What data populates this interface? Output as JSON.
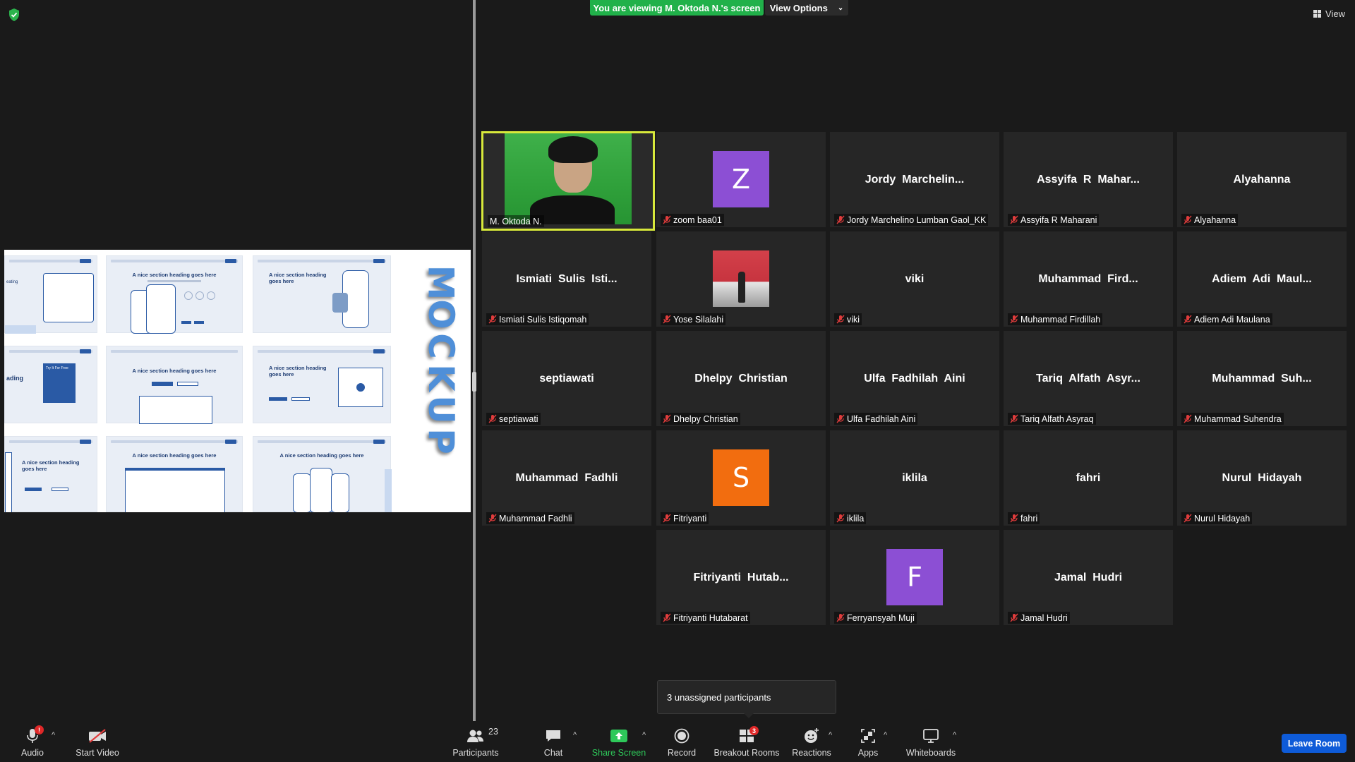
{
  "banner": {
    "viewing_text": "You are viewing M. Oktoda N.'s screen",
    "view_options_label": "View Options",
    "view_label": "View"
  },
  "shared_screen": {
    "headings": [
      "A nice section heading goes here",
      "A nice section heading goes here",
      "A nice section heading goes here",
      "A nice section heading goes here",
      "A nice section heading goes here",
      "A nice section heading goes here",
      "A nice section heading goes here",
      "A nice section heading goes here"
    ],
    "partial_left_texts": [
      "eating",
      "ading",
      "Try It For Free"
    ],
    "mockup_title": "MOCKUP"
  },
  "participants": [
    {
      "center": "",
      "label": "M. Oktoda N.",
      "type": "video",
      "muted": false
    },
    {
      "center": "",
      "label": "zoom baa01",
      "type": "avatar",
      "avatar_letter": "Z",
      "avatar_color": "#8c4fd4",
      "muted": true
    },
    {
      "center": "Jordy  Marchelin...",
      "label": "Jordy Marchelino Lumban Gaol_KK",
      "type": "name",
      "muted": true
    },
    {
      "center": "Assyifa  R  Mahar...",
      "label": "Assyifa R Maharani",
      "type": "name",
      "muted": true
    },
    {
      "center": "Alyahanna",
      "label": "Alyahanna",
      "type": "name",
      "muted": true
    },
    {
      "center": "Ismiati  Sulis  Isti...",
      "label": "Ismiati Sulis Istiqomah",
      "type": "name",
      "muted": true
    },
    {
      "center": "",
      "label": "Yose Silalahi",
      "type": "photo",
      "muted": true
    },
    {
      "center": "viki",
      "label": "viki",
      "type": "name",
      "muted": true
    },
    {
      "center": "Muhammad  Fird...",
      "label": "Muhammad Firdillah",
      "type": "name",
      "muted": true
    },
    {
      "center": "Adiem  Adi  Maul...",
      "label": "Adiem Adi Maulana",
      "type": "name",
      "muted": true
    },
    {
      "center": "septiawati",
      "label": "septiawati",
      "type": "name",
      "muted": true
    },
    {
      "center": "Dhelpy  Christian",
      "label": "Dhelpy Christian",
      "type": "name",
      "muted": true
    },
    {
      "center": "Ulfa  Fadhilah  Aini",
      "label": "Ulfa Fadhilah Aini",
      "type": "name",
      "muted": true
    },
    {
      "center": "Tariq  Alfath  Asyr...",
      "label": "Tariq Alfath Asyraq",
      "type": "name",
      "muted": true
    },
    {
      "center": "Muhammad  Suh...",
      "label": "Muhammad Suhendra",
      "type": "name",
      "muted": true
    },
    {
      "center": "Muhammad  Fadhli",
      "label": "Muhammad Fadhli",
      "type": "name",
      "muted": true
    },
    {
      "center": "",
      "label": "Fitriyanti",
      "type": "avatar",
      "avatar_letter": "S",
      "avatar_color": "#f26d0f",
      "muted": true
    },
    {
      "center": "iklila",
      "label": "iklila",
      "type": "name",
      "muted": true
    },
    {
      "center": "fahri",
      "label": "fahri",
      "type": "name",
      "muted": true
    },
    {
      "center": "Nurul  Hidayah",
      "label": "Nurul Hidayah",
      "type": "name",
      "muted": true
    },
    {
      "center": "Fitriyanti  Hutab...",
      "label": "Fitriyanti Hutabarat",
      "type": "name",
      "muted": true
    },
    {
      "center": "",
      "label": "Ferryansyah Muji",
      "type": "avatar",
      "avatar_letter": "F",
      "avatar_color": "#8c4fd4",
      "muted": true
    },
    {
      "center": "Jamal  Hudri",
      "label": "Jamal Hudri",
      "type": "name",
      "muted": true
    }
  ],
  "tooltip": {
    "text": "3 unassigned participants"
  },
  "toolbar": {
    "audio_label": "Audio",
    "audio_badge": "!",
    "start_video_label": "Start Video",
    "participants_label": "Participants",
    "participants_count": "23",
    "chat_label": "Chat",
    "share_screen_label": "Share Screen",
    "record_label": "Record",
    "breakout_rooms_label": "Breakout Rooms",
    "breakout_badge": "3",
    "reactions_label": "Reactions",
    "apps_label": "Apps",
    "whiteboards_label": "Whiteboards",
    "leave_label": "Leave Room"
  },
  "colors": {
    "banner_green": "#21b14a",
    "active_speaker_border": "#d8e93b",
    "leave_blue": "#0e5bd8",
    "share_green": "#2ec95a",
    "muted_red": "#e03c3c"
  }
}
